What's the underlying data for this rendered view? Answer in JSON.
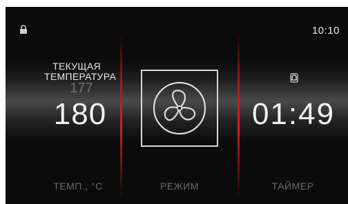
{
  "status_bar": {
    "lock_icon": "lock-icon",
    "time": "10:10"
  },
  "temperature": {
    "current_label": "ТЕКУЩАЯ ТЕМПЕРАТУРА",
    "current_value": "177",
    "set_value": "180",
    "label": "ТЕМП., °С"
  },
  "mode": {
    "icon": "fan-icon",
    "label": "РЕЖИМ"
  },
  "timer": {
    "icon": "alarm-icon",
    "value": "01:49",
    "label": "ТАЙМЕР"
  },
  "colors": {
    "background": "#0b0b0b",
    "divider": "#d22424",
    "text": "#f2f2f2",
    "muted": "#6a6a6a"
  }
}
